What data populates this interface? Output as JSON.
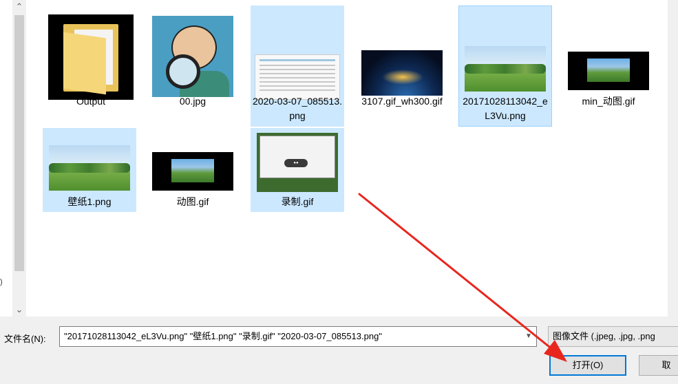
{
  "nav": {
    "edge_mark": ")"
  },
  "files": [
    {
      "name": "Output",
      "thumb": "folder-icon",
      "selected": false
    },
    {
      "name": "00.jpg",
      "thumb": "cartoon-magnifier-image",
      "selected": false
    },
    {
      "name": "2020-03-07_085513.png",
      "thumb": "screenshot-image",
      "selected": true
    },
    {
      "name": "3107.gif_wh300.gif",
      "thumb": "earth-night-image",
      "selected": false
    },
    {
      "name": "20171028113042_eL3Vu.png",
      "thumb": "landscape-image",
      "selected": true
    },
    {
      "name": "min_动图.gif",
      "thumb": "landscape-dark-image",
      "selected": false
    },
    {
      "name": "壁纸1.png",
      "thumb": "landscape-image",
      "selected": true
    },
    {
      "name": "动图.gif",
      "thumb": "landscape-dark-image",
      "selected": false
    },
    {
      "name": "录制.gif",
      "thumb": "recording-app-image",
      "selected": true
    }
  ],
  "filename": {
    "label": "文件名(N):",
    "value": "\"20171028113042_eL3Vu.png\" \"壁纸1.png\" \"录制.gif\" \"2020-03-07_085513.png\""
  },
  "filetype": {
    "selected": "图像文件 (.jpeg, .jpg, .png"
  },
  "buttons": {
    "open": "打开(O)",
    "cancel": "取"
  },
  "colors": {
    "selection": "#cce8ff",
    "focus_border": "#99d1ff",
    "annotation_arrow": "#e8261e",
    "default_button": "#0078d7"
  }
}
